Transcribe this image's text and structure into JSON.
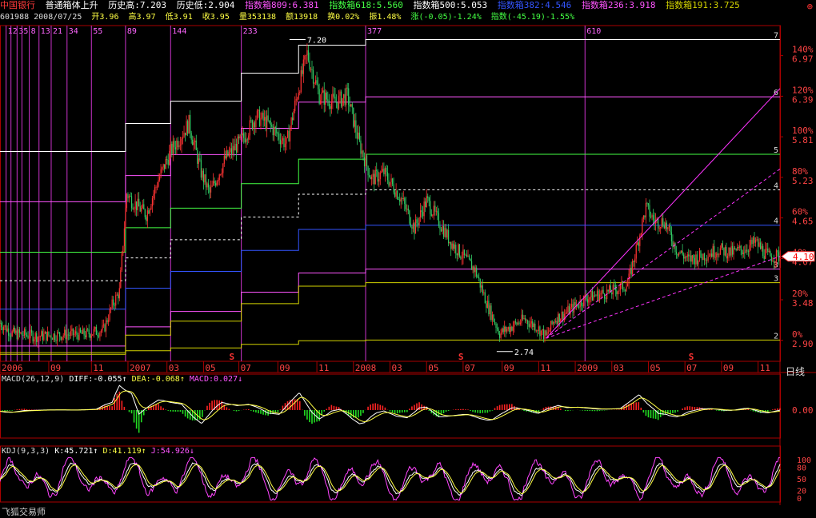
{
  "header": {
    "stock_name": "中国银行",
    "indicator_name": "普通箱体上升",
    "hist_high": "历史高:7.203",
    "hist_low": "历史低:2.904",
    "box809": "指数箱809:6.381",
    "box618": "指数箱618:5.560",
    "box500": "指数箱500:5.053",
    "box382": "指数箱382:4.546",
    "box236": "指数箱236:3.918",
    "box191": "指数箱191:3.725",
    "colors": {
      "stock_name": "#ff3b3b",
      "box809": "#ff55ff",
      "box618": "#44ff44",
      "box500": "#ffffff",
      "box382": "#3355ff",
      "box236": "#ff55ff",
      "box191": "#d4d400"
    }
  },
  "quote": {
    "code_date": "601988 2008/07/25",
    "open": "开3.96",
    "high": "高3.97",
    "low": "低3.91",
    "close": "收3.95",
    "volume": "量353138",
    "amount": "额13918",
    "turnover": "换0.02%",
    "amplitude": "振1.48%",
    "change": "涨(-0.05)-1.24%",
    "index_change": "指数(-45.19)-1.55%"
  },
  "chart_data": [
    {
      "type": "line",
      "title": "",
      "price_axis": {
        "ylim": [
          2.6,
          7.4
        ],
        "ticks": [
          "6.97",
          "6.39",
          "5.81",
          "5.23",
          "4.65",
          "4.07",
          "3.48",
          "2.90"
        ],
        "tick_values": [
          6.97,
          6.39,
          5.81,
          5.23,
          4.65,
          4.07,
          3.48,
          2.9
        ]
      },
      "pct_axis": {
        "ticks": [
          "140%",
          "120%",
          "100%",
          "80%",
          "60%",
          "40%",
          "20%",
          "0%"
        ],
        "tick_values": [
          140,
          120,
          100,
          80,
          60,
          40,
          20,
          0
        ]
      },
      "current_price": "4.10",
      "current_price_value": 4.1,
      "x_labels": [
        "2006",
        "09",
        "11",
        "2007",
        "03",
        "05",
        "07",
        "09",
        "11",
        "2008",
        "03",
        "05",
        "07",
        "09",
        "11",
        "2009",
        "03",
        "05",
        "07",
        "09",
        "11"
      ],
      "x_label_index": [
        0,
        40,
        75,
        105,
        137,
        167,
        196,
        228,
        260,
        290,
        320,
        350,
        380,
        412,
        442,
        472,
        502,
        532,
        562,
        592,
        622
      ],
      "fib_lines": [
        {
          "label": "1",
          "index": 5
        },
        {
          "label": "2",
          "index": 9
        },
        {
          "label": "3",
          "index": 14
        },
        {
          "label": "5",
          "index": 18
        },
        {
          "label": "8",
          "index": 24
        },
        {
          "label": "13",
          "index": 32
        },
        {
          "label": "21",
          "index": 42
        },
        {
          "label": "34",
          "index": 55
        },
        {
          "label": "55",
          "index": 75
        },
        {
          "label": "89",
          "index": 103
        },
        {
          "label": "144",
          "index": 140
        },
        {
          "label": "233",
          "index": 198
        },
        {
          "label": "377",
          "index": 300
        },
        {
          "label": "610",
          "index": 480
        }
      ],
      "box_lines": [
        {
          "name": "top",
          "value": 7.2,
          "color": "#ffffff",
          "end_label": "7"
        },
        {
          "name": "809",
          "value": 6.381,
          "color": "#ff55ff",
          "end_label": "6"
        },
        {
          "name": "618",
          "value": 5.56,
          "color": "#44ff44",
          "end_label": "5"
        },
        {
          "name": "500",
          "value": 5.053,
          "color": "#ffffff",
          "end_label": "4",
          "dashed": true
        },
        {
          "name": "382",
          "value": 4.546,
          "color": "#3355ff",
          "end_label": "4"
        },
        {
          "name": "236",
          "value": 3.918,
          "color": "#ff55ff",
          "end_label": "3"
        },
        {
          "name": "191",
          "value": 3.725,
          "color": "#d4d400",
          "end_label": "3"
        },
        {
          "name": "bottom",
          "value": 2.904,
          "color": "#d4d400",
          "end_label": "2"
        }
      ],
      "annotations": [
        {
          "text": "7.20",
          "index": 252,
          "value": 7.2
        },
        {
          "text": "2.74",
          "index": 422,
          "value": 2.74
        }
      ],
      "signal_marks": [
        {
          "text": "S",
          "index": 190
        },
        {
          "text": "S",
          "index": 378
        },
        {
          "text": "S",
          "index": 567
        }
      ],
      "series_close_keypoints": [
        [
          0,
          3.15
        ],
        [
          10,
          3.0
        ],
        [
          30,
          2.96
        ],
        [
          50,
          2.98
        ],
        [
          70,
          2.99
        ],
        [
          85,
          3.05
        ],
        [
          92,
          3.4
        ],
        [
          98,
          3.6
        ],
        [
          104,
          5.0
        ],
        [
          108,
          4.9
        ],
        [
          120,
          4.7
        ],
        [
          130,
          5.2
        ],
        [
          140,
          5.6
        ],
        [
          155,
          6.0
        ],
        [
          165,
          5.3
        ],
        [
          172,
          5.0
        ],
        [
          185,
          5.5
        ],
        [
          200,
          5.8
        ],
        [
          210,
          6.1
        ],
        [
          220,
          6.0
        ],
        [
          235,
          5.7
        ],
        [
          245,
          6.5
        ],
        [
          252,
          7.0
        ],
        [
          262,
          6.4
        ],
        [
          275,
          6.3
        ],
        [
          285,
          6.4
        ],
        [
          295,
          5.7
        ],
        [
          305,
          5.2
        ],
        [
          315,
          5.3
        ],
        [
          330,
          4.9
        ],
        [
          340,
          4.5
        ],
        [
          350,
          4.9
        ],
        [
          360,
          4.6
        ],
        [
          370,
          4.3
        ],
        [
          380,
          4.1
        ],
        [
          390,
          3.9
        ],
        [
          400,
          3.4
        ],
        [
          410,
          3.0
        ],
        [
          420,
          3.1
        ],
        [
          430,
          3.2
        ],
        [
          440,
          3.1
        ],
        [
          448,
          2.95
        ],
        [
          455,
          3.2
        ],
        [
          465,
          3.3
        ],
        [
          480,
          3.5
        ],
        [
          490,
          3.55
        ],
        [
          502,
          3.6
        ],
        [
          515,
          3.7
        ],
        [
          522,
          4.2
        ],
        [
          530,
          4.8
        ],
        [
          537,
          4.6
        ],
        [
          545,
          4.6
        ],
        [
          555,
          4.2
        ],
        [
          565,
          4.05
        ],
        [
          575,
          4.1
        ],
        [
          590,
          4.2
        ],
        [
          600,
          4.15
        ],
        [
          610,
          4.2
        ],
        [
          620,
          4.3
        ],
        [
          630,
          4.1
        ]
      ],
      "trend_lines": [
        {
          "from": [
            448,
            2.93
          ],
          "to": [
            640,
            6.5
          ],
          "dashed": false
        },
        {
          "from": [
            448,
            2.93
          ],
          "to": [
            640,
            5.35
          ],
          "dashed": true
        },
        {
          "from": [
            448,
            2.93
          ],
          "to": [
            640,
            4.1
          ],
          "dashed": true
        }
      ]
    },
    {
      "type": "bar",
      "title": "MACD(26,12,9)",
      "diff": "DIFF:-0.055",
      "dea": "DEA:-0.068",
      "macd": "MACD:0.027",
      "ticks": [
        "0.00"
      ],
      "ylim": [
        -0.45,
        0.45
      ]
    },
    {
      "type": "line",
      "title": "KDJ(9,3,3)",
      "k": "K:45.721",
      "d": "D:41.119",
      "j": "J:54.926",
      "ticks": [
        "100",
        "80",
        "50",
        "20",
        "0"
      ],
      "tick_values": [
        100,
        80,
        50,
        20,
        0
      ],
      "ylim": [
        -10,
        110
      ]
    }
  ],
  "period_label": "日线",
  "footer": "飞狐交易师"
}
